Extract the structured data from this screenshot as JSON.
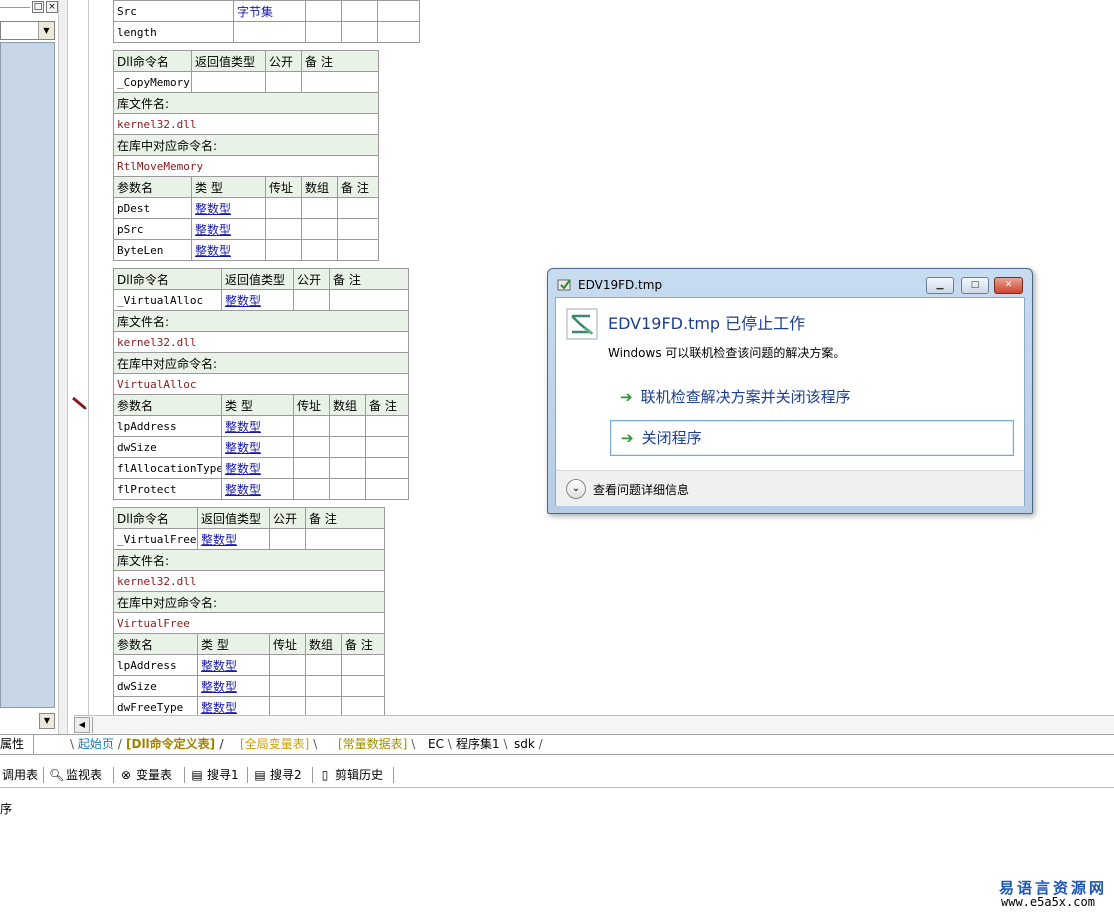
{
  "tables": [
    {
      "rows": [
        {
          "cells": [
            "Src",
            "字节集",
            "",
            "",
            ""
          ]
        },
        {
          "cells": [
            "length",
            "",
            "",
            "",
            ""
          ]
        }
      ]
    },
    {
      "header": [
        "Dll命令名",
        "返回值类型",
        "公开",
        "备 注"
      ],
      "name_row": [
        "_CopyMemory",
        "",
        "",
        ""
      ],
      "lib_label": "库文件名:",
      "lib_value": "kernel32.dll",
      "cmd_label": "在库中对应命令名:",
      "cmd_value": "RtlMoveMemory",
      "param_header": [
        "参数名",
        "类 型",
        "传址",
        "数组",
        "备 注"
      ],
      "params": [
        {
          "name": "pDest",
          "type": "整数型"
        },
        {
          "name": "pSrc",
          "type": "整数型"
        },
        {
          "name": "ByteLen",
          "type": "整数型"
        }
      ]
    },
    {
      "header": [
        "Dll命令名",
        "返回值类型",
        "公开",
        "备 注"
      ],
      "name_row": [
        "_VirtualAlloc",
        "整数型",
        "",
        ""
      ],
      "lib_label": "库文件名:",
      "lib_value": "kernel32.dll",
      "cmd_label": "在库中对应命令名:",
      "cmd_value": "VirtualAlloc",
      "param_header": [
        "参数名",
        "类 型",
        "传址",
        "数组",
        "备 注"
      ],
      "params": [
        {
          "name": "lpAddress",
          "type": "整数型"
        },
        {
          "name": "dwSize",
          "type": "整数型"
        },
        {
          "name": "flAllocationType",
          "type": "整数型"
        },
        {
          "name": "flProtect",
          "type": "整数型"
        }
      ]
    },
    {
      "header": [
        "Dll命令名",
        "返回值类型",
        "公开",
        "备 注"
      ],
      "name_row": [
        "_VirtualFree",
        "整数型",
        "",
        ""
      ],
      "lib_label": "库文件名:",
      "lib_value": "kernel32.dll",
      "cmd_label": "在库中对应命令名:",
      "cmd_value": "VirtualFree",
      "param_header": [
        "参数名",
        "类 型",
        "传址",
        "数组",
        "备 注"
      ],
      "params": [
        {
          "name": "lpAddress",
          "type": "整数型"
        },
        {
          "name": "dwSize",
          "type": "整数型"
        },
        {
          "name": "dwFreeType",
          "type": "整数型"
        }
      ]
    }
  ],
  "left_panel": {
    "prop_tab": "属性"
  },
  "tabs": [
    {
      "label": "起始页",
      "color": "#1a7ab0"
    },
    {
      "label": "[Dll命令定义表]",
      "color": "#a08000",
      "active": true
    },
    {
      "label": "[全局变量表]",
      "color": "#c8a000"
    },
    {
      "label": "[常量数据表]",
      "color": "#a09000"
    },
    {
      "label": "EC",
      "color": "#000000"
    },
    {
      "label": "程序集1",
      "color": "#000000"
    },
    {
      "label": "sdk",
      "color": "#000000"
    }
  ],
  "toolbar": {
    "items": [
      {
        "label": "调用表",
        "icon": "call-table-icon"
      },
      {
        "label": "监视表",
        "icon": "magnifier-icon"
      },
      {
        "label": "变量表",
        "icon": "variables-icon"
      },
      {
        "label": "搜寻1",
        "icon": "search-doc-icon"
      },
      {
        "label": "搜寻2",
        "icon": "search-doc-icon"
      },
      {
        "label": "剪辑历史",
        "icon": "clipboard-history-icon"
      }
    ]
  },
  "output": {
    "text": "序"
  },
  "dialog": {
    "title": "EDV19FD.tmp",
    "heading": "EDV19FD.tmp 已停止工作",
    "description": "Windows 可以联机检查该问题的解决方案。",
    "option_online": "联机检查解决方案并关闭该程序",
    "option_close": "关闭程序",
    "details_label": "查看问题详细信息"
  },
  "watermark": {
    "site_name": "易语言资源网",
    "url": "www.e5a5x.com"
  }
}
